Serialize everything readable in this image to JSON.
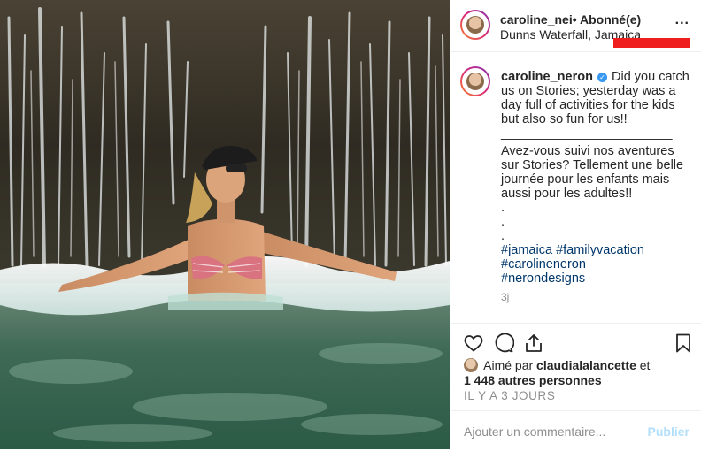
{
  "post": {
    "username": "caroline_nei",
    "follow_status": "• Abonné(e)",
    "location": "Dunns Waterfall, Jamaica",
    "more_label": "...",
    "verified_glyph": "✓"
  },
  "caption": {
    "username": "caroline_neron",
    "text_en": "Did you catch us on Stories; yesterday was a day full of activities for the kids but also so fun for us!!",
    "divider": "________________________",
    "text_fr": "Avez-vous suivi nos aventures sur Stories? Tellement une belle journée pour les enfants mais aussi pour les adultes!!",
    "dots": ".\n.\n.",
    "hashtags": [
      "#jamaica",
      "#familyvacation",
      "#carolineneron",
      "#nerondesigns"
    ],
    "time_ago": "3j"
  },
  "actions": {
    "like_icon": "heart-icon",
    "comment_icon": "comment-icon",
    "share_icon": "share-icon",
    "save_icon": "bookmark-icon"
  },
  "likes": {
    "prefix": "Aimé par",
    "user": "claudialalancette",
    "joiner": "et",
    "others": "1 448 autres personnes"
  },
  "date": "IL Y A 3 JOURS",
  "comment_box": {
    "placeholder": "Ajouter un commentaire...",
    "post_label": "Publier"
  },
  "colors": {
    "link": "#00376b",
    "verified": "#3897f0",
    "muted": "#8e8e8e",
    "post_disabled": "#b2dffc",
    "redaction": "#f01f1f"
  }
}
